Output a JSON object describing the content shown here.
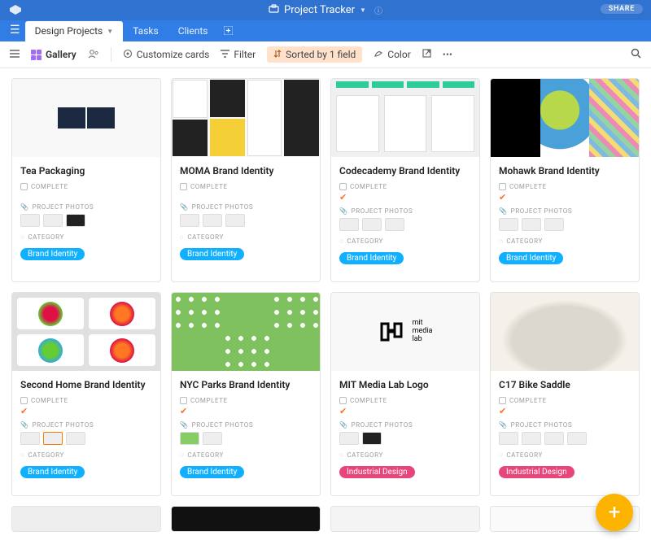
{
  "topbar": {
    "title": "Project Tracker",
    "share": "SHARE"
  },
  "tabs": {
    "active": "Design Projects",
    "items": [
      "Design Projects",
      "Tasks",
      "Clients"
    ]
  },
  "toolbar": {
    "view": "Gallery",
    "customize": "Customize cards",
    "filter": "Filter",
    "sorted": "Sorted by 1 field",
    "color": "Color"
  },
  "field_labels": {
    "complete": "COMPLETE",
    "photos": "PROJECT PHOTOS",
    "category": "CATEGORY"
  },
  "categories": {
    "brand": "Brand Identity",
    "industrial": "Industrial Design"
  },
  "cards": [
    {
      "title": "Tea Packaging",
      "complete_checked": false,
      "category": "brand"
    },
    {
      "title": "MOMA Brand Identity",
      "complete_checked": false,
      "category": "brand"
    },
    {
      "title": "Codecademy Brand Identity",
      "complete_checked": true,
      "category": "brand"
    },
    {
      "title": "Mohawk Brand Identity",
      "complete_checked": true,
      "category": "brand"
    },
    {
      "title": "Second Home Brand Identity",
      "complete_checked": true,
      "category": "brand"
    },
    {
      "title": "NYC Parks Brand Identity",
      "complete_checked": true,
      "category": "brand"
    },
    {
      "title": "MIT Media Lab Logo",
      "complete_checked": true,
      "category": "industrial"
    },
    {
      "title": "C17 Bike Saddle",
      "complete_checked": true,
      "category": "industrial"
    }
  ],
  "mit_text": "mit\nmedia\nlab"
}
